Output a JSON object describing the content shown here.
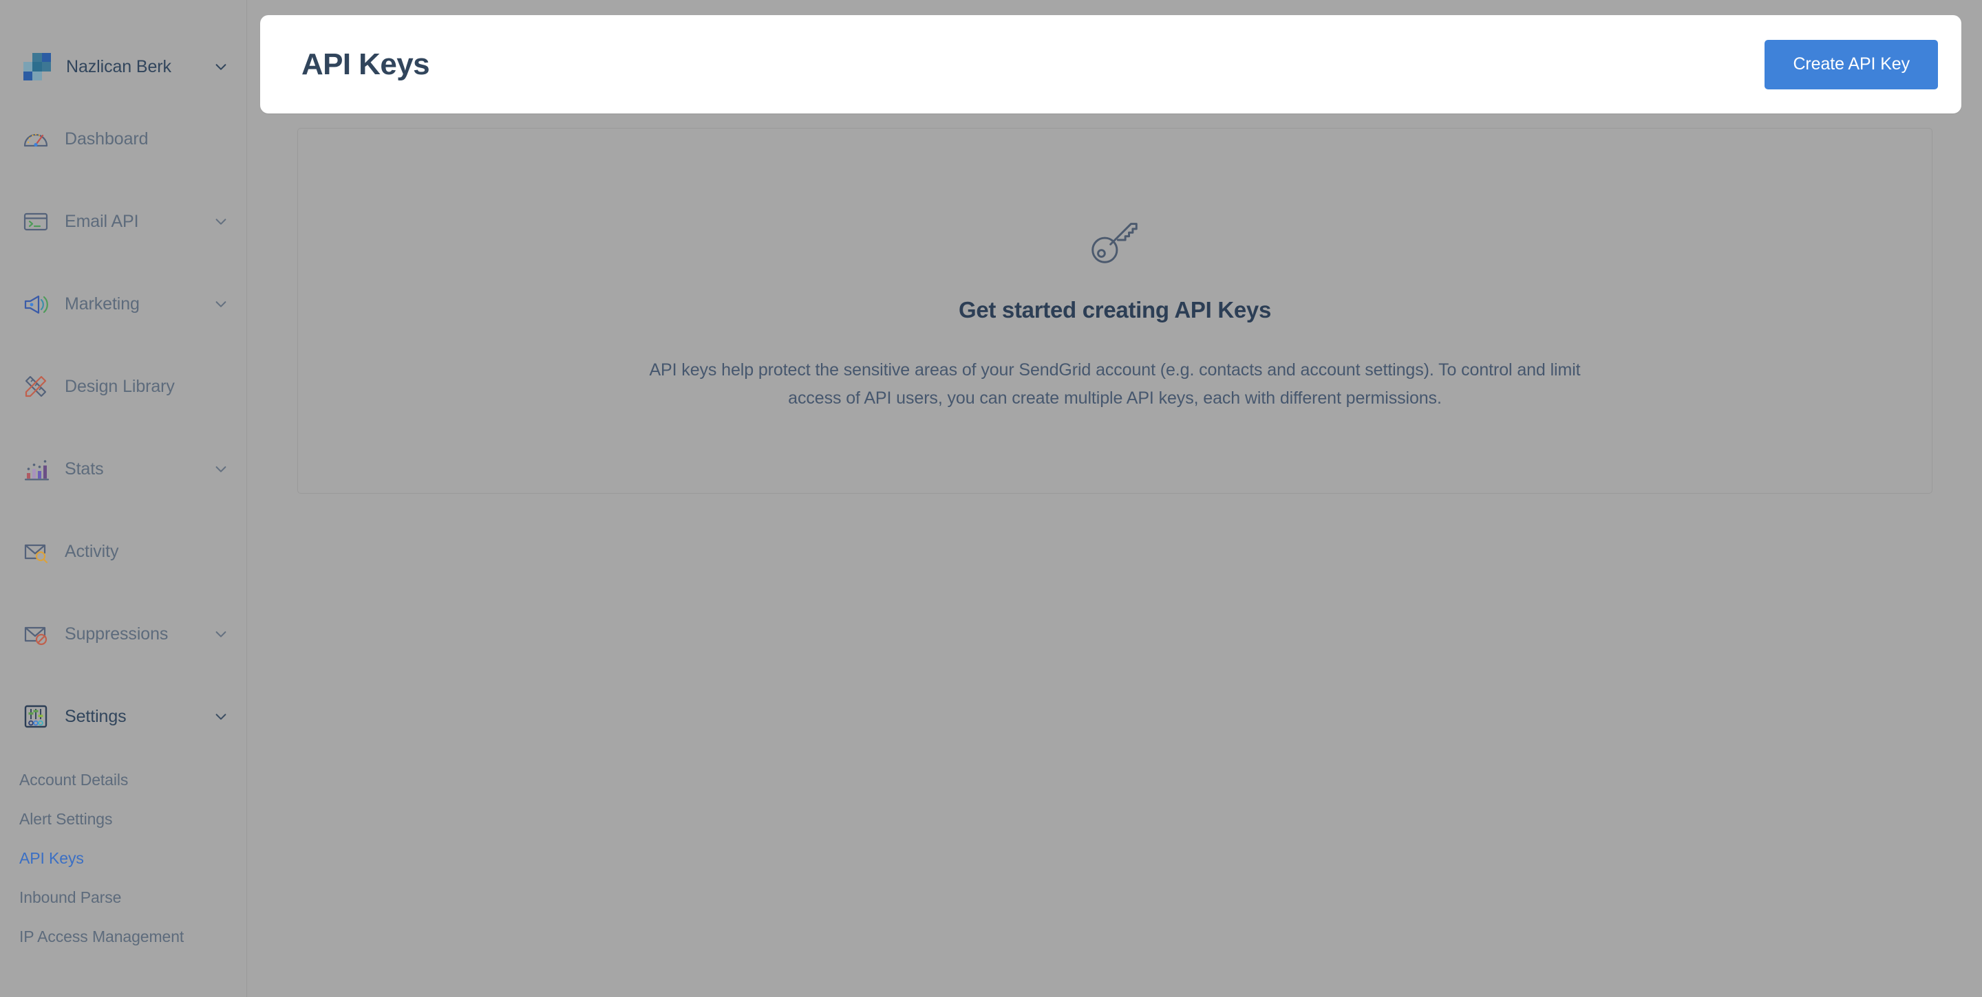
{
  "account": {
    "name": "Nazlican Berk",
    "logo_colors": [
      "#3d7794",
      "#2f5fa5",
      "#7ba2b4",
      "#2f5fa5",
      "#2d6e8e",
      "#2b5ca3",
      "#8aa9b8",
      "#2f6ea0"
    ],
    "caret_icon": "chevron-down-icon"
  },
  "sidebar": {
    "items": [
      {
        "label": "Dashboard",
        "icon": "gauge-icon",
        "expandable": false,
        "expanded": false
      },
      {
        "label": "Email API",
        "icon": "terminal-icon",
        "expandable": true,
        "expanded": false
      },
      {
        "label": "Marketing",
        "icon": "megaphone-icon",
        "expandable": true,
        "expanded": false
      },
      {
        "label": "Design Library",
        "icon": "ruler-pencil-icon",
        "expandable": false,
        "expanded": false
      },
      {
        "label": "Stats",
        "icon": "bar-chart-icon",
        "expandable": true,
        "expanded": false
      },
      {
        "label": "Activity",
        "icon": "envelope-search-icon",
        "expandable": false,
        "expanded": false
      },
      {
        "label": "Suppressions",
        "icon": "envelope-block-icon",
        "expandable": true,
        "expanded": false
      },
      {
        "label": "Settings",
        "icon": "sliders-icon",
        "expandable": true,
        "expanded": true
      }
    ],
    "settings_submenu": [
      {
        "label": "Account Details",
        "active": false
      },
      {
        "label": "Alert Settings",
        "active": false
      },
      {
        "label": "API Keys",
        "active": true
      },
      {
        "label": "Inbound Parse",
        "active": false
      },
      {
        "label": "IP Access Management",
        "active": false
      }
    ]
  },
  "header": {
    "title": "API Keys",
    "create_button_label": "Create API Key",
    "create_button_color": "#3f82d9"
  },
  "empty_state": {
    "icon": "key-icon",
    "title": "Get started creating API Keys",
    "description": "API keys help protect the sensitive areas of your SendGrid account (e.g. contacts and account settings). To control and limit access of API users, you can create multiple API keys, each with different permissions."
  },
  "theme": {
    "page_background": "#a6a6a6",
    "panel_background": "#ffffff",
    "title_color": "#31455c",
    "muted_text_color": "#5d6b7c",
    "active_link_color": "#3b6fc4",
    "border_color": "#9a9a9a"
  }
}
